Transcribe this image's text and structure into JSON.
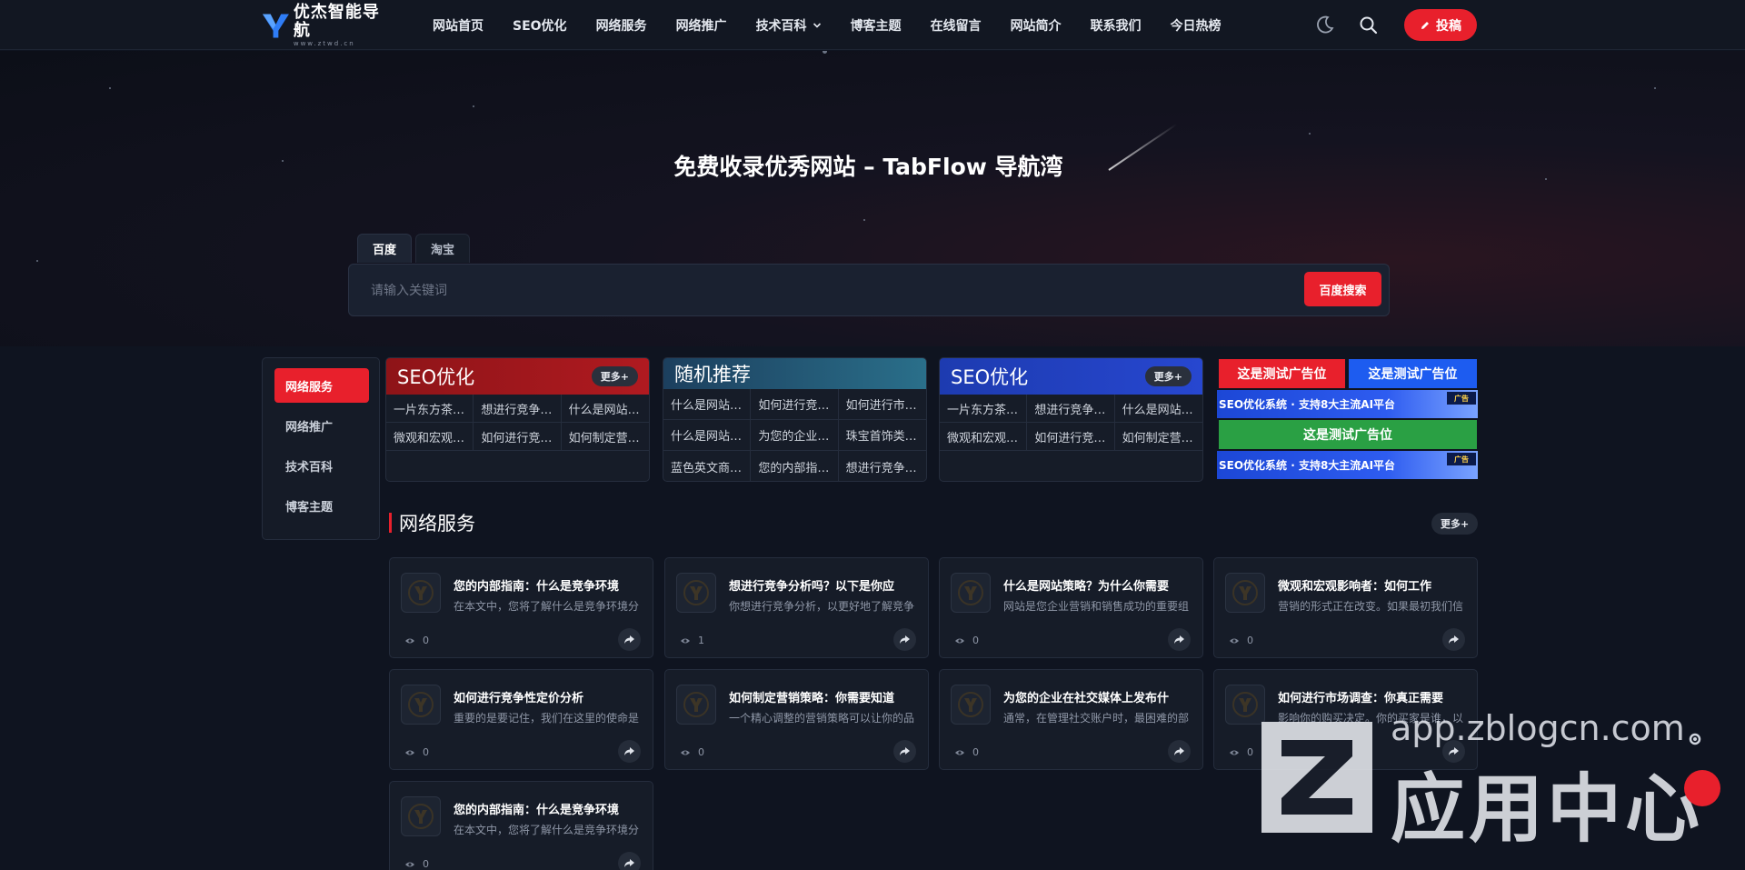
{
  "brand": {
    "name": "优杰智能导航",
    "subtitle": "www.ztwd.cn"
  },
  "nav": {
    "items": [
      "网站首页",
      "SEO优化",
      "网络服务",
      "网络推广",
      "技术百科",
      "博客主题",
      "在线留言",
      "网站简介",
      "联系我们",
      "今日热榜"
    ],
    "submit_label": "投稿"
  },
  "hero": {
    "title": "免费收录优秀网站 – TabFlow 导航湾",
    "tabs": [
      "百度",
      "淘宝"
    ],
    "placeholder": "请输入关键词",
    "search_button": "百度搜索"
  },
  "sidebar": {
    "items": [
      "网络服务",
      "网络推广",
      "技术百科",
      "博客主题"
    ]
  },
  "category_boxes": [
    {
      "title": "SEO优化",
      "more": "更多+",
      "links": [
        "一片东方茶…",
        "想进行竞争…",
        "什么是网站…",
        "微观和宏观…",
        "如何进行竞…",
        "如何制定营…"
      ]
    },
    {
      "title": "随机推荐",
      "links": [
        "什么是网站…",
        "如何进行竞…",
        "如何进行市…",
        "什么是网站…",
        "为您的企业…",
        "珠宝首饰类…",
        "蓝色英文商…",
        "您的内部指…",
        "想进行竞争…"
      ]
    },
    {
      "title": "SEO优化",
      "more": "更多+",
      "links": [
        "一片东方茶…",
        "想进行竞争…",
        "什么是网站…",
        "微观和宏观…",
        "如何进行竞…",
        "如何制定营…"
      ]
    }
  ],
  "ads": {
    "top_left": "这是测试广告位",
    "top_right": "这是测试广告位",
    "banner": "SEO优化系统 · 支持8大主流AI平台",
    "banner_tag": "广告",
    "middle": "这是测试广告位",
    "colors": {
      "red": "#e8202c",
      "blue": "#1d5cf0",
      "green": "#2aa044"
    }
  },
  "section": {
    "title": "网络服务",
    "more": "更多+"
  },
  "cards": [
    {
      "title": "您的内部指南：什么是竞争环境",
      "desc": "在本文中，您将了解什么是竞争环境分",
      "views": "0"
    },
    {
      "title": "想进行竞争分析吗？以下是你应",
      "desc": "你想进行竞争分析，以更好地了解竞争",
      "views": "1"
    },
    {
      "title": "什么是网站策略？为什么你需要",
      "desc": "网站是您企业营销和销售成功的重要组",
      "views": "0"
    },
    {
      "title": "微观和宏观影响者：如何工作",
      "desc": "营销的形式正在改变。如果最初我们信",
      "views": "0"
    },
    {
      "title": "如何进行竞争性定价分析",
      "desc": "重要的是要记住，我们在这里的使命是",
      "views": "0"
    },
    {
      "title": "如何制定营销策略：你需要知道",
      "desc": "一个精心调整的营销策略可以让你的品",
      "views": "0"
    },
    {
      "title": "为您的企业在社交媒体上发布什",
      "desc": "通常，在管理社交账户时，最困难的部",
      "views": "0"
    },
    {
      "title": "如何进行市场调查：你真正需要",
      "desc": "影响你的购买决定。你的买家是谁，以",
      "views": "0"
    },
    {
      "title": "您的内部指南：什么是竞争环境",
      "desc": "在本文中，您将了解什么是竞争环境分",
      "views": "0"
    }
  ],
  "watermark": {
    "url": "app.zblogcn.com",
    "text": "应用中心"
  },
  "colors": {
    "accent": "#e8202c",
    "background": "#0f1420",
    "card": "#161c28"
  }
}
